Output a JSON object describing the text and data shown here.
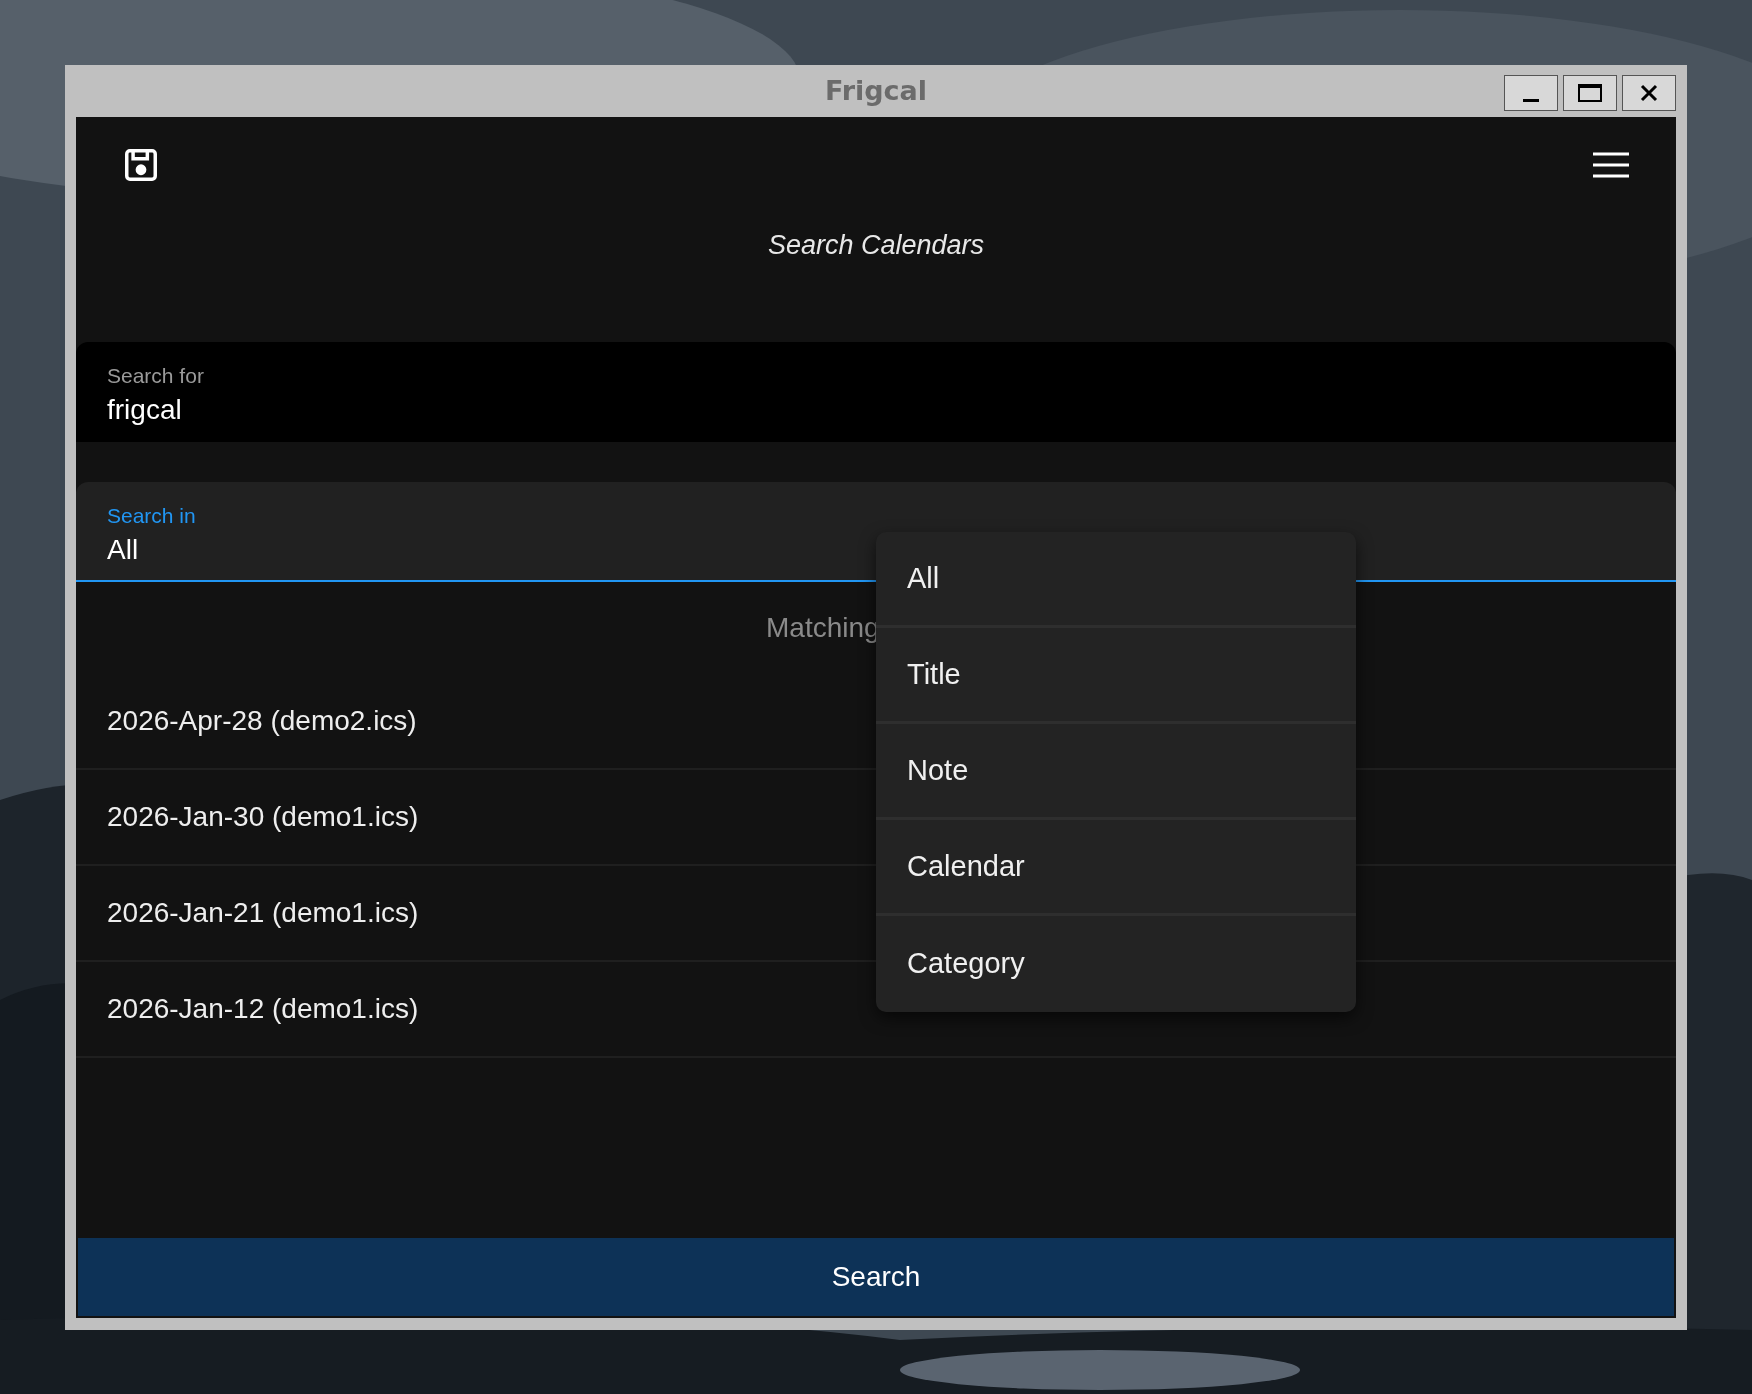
{
  "window": {
    "title": "Frigcal"
  },
  "heading": "Search Calendars",
  "search_for": {
    "label": "Search for",
    "value": "frigcal"
  },
  "search_in": {
    "label": "Search in",
    "value": "All",
    "expanded": true
  },
  "results_heading": "Matching",
  "results": [
    "2026-Apr-28 (demo2.ics)",
    "2026-Jan-30 (demo1.ics)",
    "2026-Jan-21 (demo1.ics)",
    "2026-Jan-12 (demo1.ics)"
  ],
  "dropdown_options": [
    "All",
    "Title",
    "Note",
    "Calendar",
    "Category"
  ],
  "search_button": "Search"
}
